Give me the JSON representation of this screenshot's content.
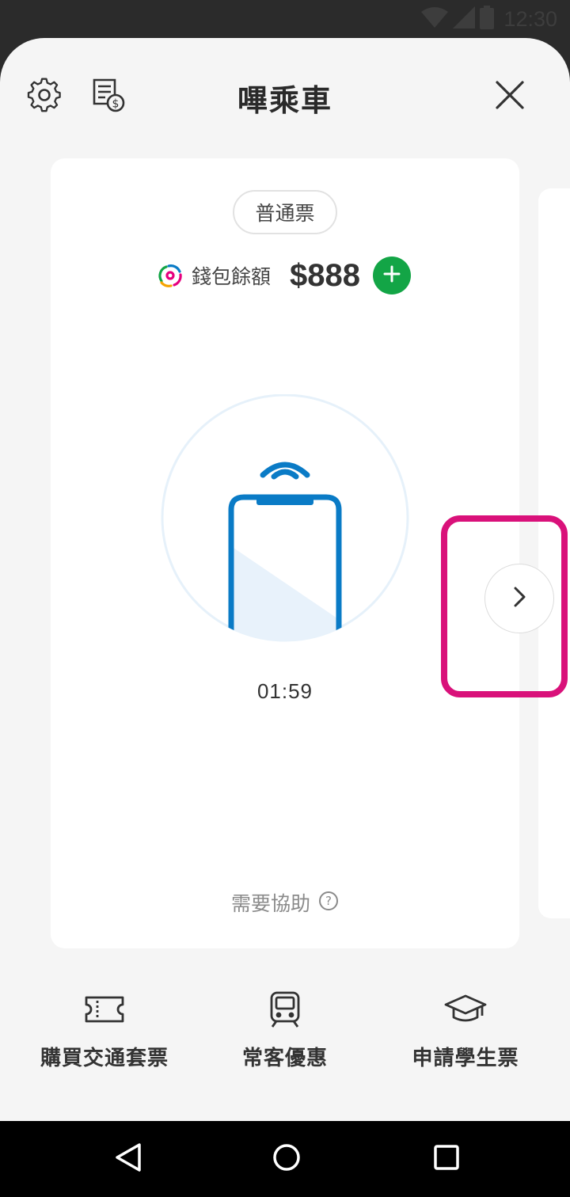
{
  "status_bar": {
    "time": "12:30"
  },
  "header": {
    "title": "嗶乘車",
    "settings_icon": "gear-icon",
    "history_icon": "receipt-dollar-icon",
    "close_icon": "close-icon"
  },
  "ticket_card": {
    "ticket_type": "普通票",
    "wallet_label": "錢包餘額",
    "balance": "$888",
    "timer": "01:59",
    "help_label": "需要協助"
  },
  "bottom_actions": [
    {
      "label": "購買交通套票",
      "icon": "ticket-icon"
    },
    {
      "label": "常客優惠",
      "icon": "train-icon"
    },
    {
      "label": "申請學生票",
      "icon": "graduation-cap-icon"
    }
  ],
  "colors": {
    "accent_blue": "#0a7bc6",
    "add_green": "#13a546",
    "highlight_pink": "#d9117a"
  }
}
